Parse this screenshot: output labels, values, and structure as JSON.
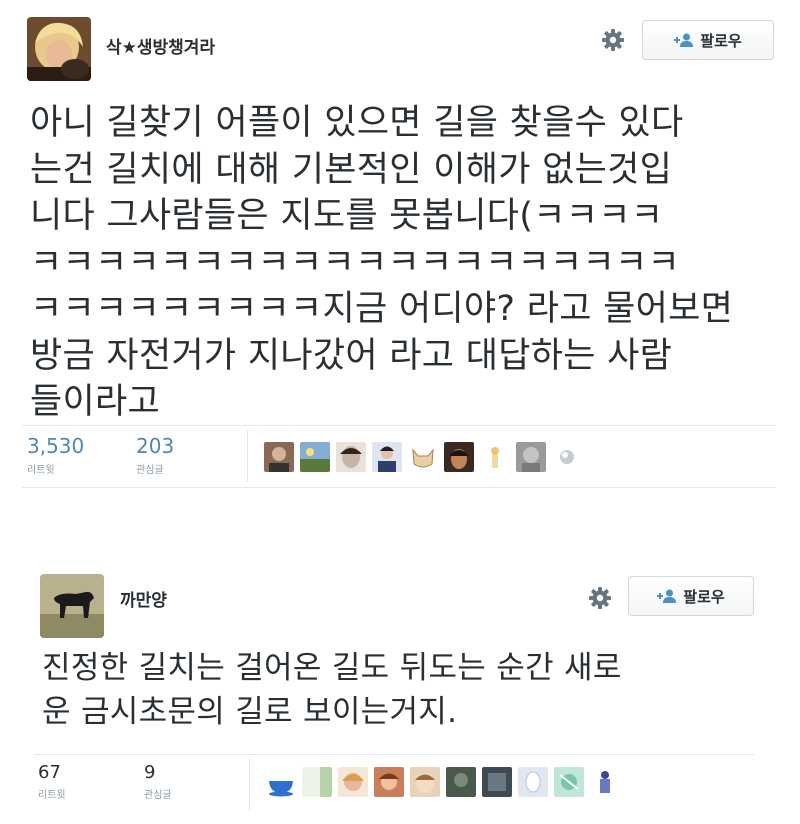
{
  "tweets": [
    {
      "username": "삭★생방챙겨라",
      "follow_label": "팔로우",
      "text_lines": [
        "아니 길찾기 어플이 있으면 길을 찾을수 있다",
        "는건 길치에 대해 기본적인 이해가 없는것입",
        "니다 그사람들은 지도를 못봅니다(ㅋㅋㅋㅋ",
        "ㅋㅋㅋㅋㅋㅋㅋㅋㅋㅋㅋㅋㅋㅋㅋㅋㅋㅋㅋㅋ",
        "ㅋㅋㅋㅋㅋㅋㅋㅋㅋ지금 어디야? 라고 물어보면",
        "방금 자전거가 지나갔어 라고 대답하는 사람",
        "들이라고"
      ],
      "retweets": "3,530",
      "retweets_label": "리트윗",
      "favorites": "203",
      "favorites_label": "관심글"
    },
    {
      "username": "까만양",
      "follow_label": "팔로우",
      "text_lines": [
        "진정한 길치는 걸어온 길도 뒤도는 순간 새로",
        "운 금시초문의 길로 보이는거지."
      ],
      "retweets": "67",
      "retweets_label": "리트윗",
      "favorites": "9",
      "favorites_label": "관심글"
    }
  ],
  "icons": {
    "settings": "gear-icon",
    "follow": "add-person-icon"
  },
  "colors": {
    "stat_blue": "#4d88b5",
    "follow_icon": "#4d8fc9"
  }
}
